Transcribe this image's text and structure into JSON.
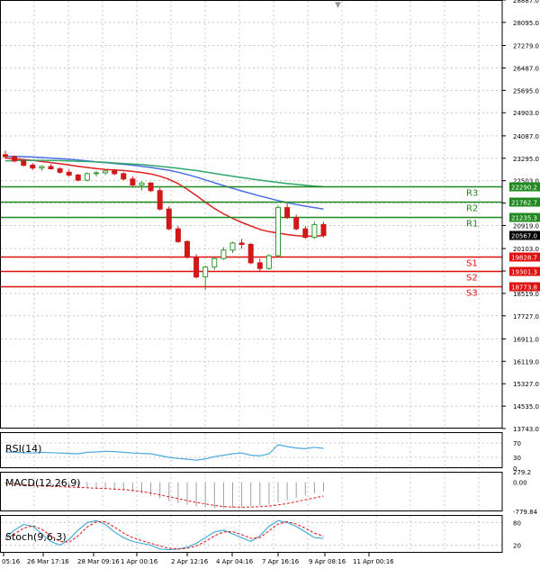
{
  "colors": {
    "background": "#ffffff",
    "grid": "#c8c8c8",
    "frame": "#000000",
    "bull_candle": "#2f9a2f",
    "bear_candle": "#d01818",
    "resistance": "#1f8a1f",
    "support": "#e01010",
    "ma_fast": "#e02020",
    "ma_mid": "#4a6fe0",
    "ma_slow": "#2fa86a",
    "rsi": "#4aa8e0",
    "macd_hist": "#a0a0a0",
    "macd_signal": "#e02020",
    "stoch_main": "#3aa8d8",
    "stoch_signal": "#e02020",
    "label_box_green": "#1f8a1f",
    "label_box_red": "#e01010",
    "price_box": "#000000"
  },
  "chart_data": [
    {
      "type": "candlestick",
      "title": "",
      "ylim": [
        13743.0,
        28887.0
      ],
      "y_ticks": [
        "28887.0",
        "28095.0",
        "27279.0",
        "26487.0",
        "25695.0",
        "24903.0",
        "24087.0",
        "23295.0",
        "22503.0",
        "21711.0",
        "20919.0",
        "20103.0",
        "19311.0",
        "18519.0",
        "17727.0",
        "16911.0",
        "16119.0",
        "15327.0",
        "14535.0",
        "13743.0"
      ],
      "x_ticks": [
        "05:16",
        "26 Mar 17:16",
        "28 Mar 09:16",
        "1 Apr 00:16",
        "2 Apr 12:16",
        "4 Apr 04:16",
        "7 Apr 16:16",
        "9 Apr 08:16",
        "11 Apr 00:16"
      ],
      "levels": [
        {
          "label": "R3",
          "value": 22290.2,
          "value_text": "22290.2",
          "kind": "resistance"
        },
        {
          "label": "R2",
          "value": 21762.7,
          "value_text": "21762.7",
          "kind": "resistance"
        },
        {
          "label": "R1",
          "value": 21235.3,
          "value_text": "21235.3",
          "kind": "resistance"
        },
        {
          "label": "S1",
          "value": 19828.7,
          "value_text": "19828.7",
          "kind": "support"
        },
        {
          "label": "S2",
          "value": 19301.3,
          "value_text": "19301.3",
          "kind": "support"
        },
        {
          "label": "S3",
          "value": 18773.8,
          "value_text": "18773.8",
          "kind": "support"
        }
      ],
      "current_price": {
        "value": 20567.0,
        "text": "20567.0"
      },
      "candles": [
        [
          23420,
          23560,
          23280,
          23350
        ],
        [
          23350,
          23400,
          23150,
          23200
        ],
        [
          23200,
          23250,
          23000,
          23050
        ],
        [
          23050,
          23120,
          22880,
          22950
        ],
        [
          22950,
          23050,
          22850,
          23000
        ],
        [
          23000,
          23080,
          22900,
          22920
        ],
        [
          22920,
          22980,
          22750,
          22800
        ],
        [
          22800,
          22900,
          22650,
          22700
        ],
        [
          22700,
          22750,
          22480,
          22520
        ],
        [
          22520,
          22800,
          22480,
          22750
        ],
        [
          22750,
          22850,
          22650,
          22780
        ],
        [
          22780,
          22900,
          22700,
          22850
        ],
        [
          22850,
          22900,
          22700,
          22750
        ],
        [
          22750,
          22800,
          22520,
          22560
        ],
        [
          22560,
          22650,
          22300,
          22350
        ],
        [
          22350,
          22480,
          22150,
          22420
        ],
        [
          22420,
          22450,
          22100,
          22150
        ],
        [
          22150,
          22250,
          21450,
          21500
        ],
        [
          21500,
          21600,
          20750,
          20800
        ],
        [
          20800,
          20900,
          20300,
          20350
        ],
        [
          20350,
          20400,
          19750,
          19800
        ],
        [
          19800,
          19900,
          19050,
          19100
        ],
        [
          19100,
          19500,
          18650,
          19450
        ],
        [
          19450,
          19800,
          19350,
          19750
        ],
        [
          19750,
          20150,
          19700,
          20050
        ],
        [
          20050,
          20350,
          19950,
          20300
        ],
        [
          20300,
          20450,
          20100,
          20250
        ],
        [
          20250,
          20300,
          19550,
          19600
        ],
        [
          19600,
          19750,
          19300,
          19400
        ],
        [
          19400,
          19900,
          19350,
          19850
        ],
        [
          19850,
          21650,
          19800,
          21550
        ],
        [
          21550,
          21700,
          21150,
          21200
        ],
        [
          21200,
          21300,
          20750,
          20800
        ],
        [
          20800,
          20900,
          20450,
          20500
        ],
        [
          20500,
          21050,
          20450,
          20950
        ],
        [
          20950,
          21050,
          20500,
          20567
        ]
      ],
      "series": [
        {
          "name": "",
          "values": [
            23300,
            23280,
            23250,
            23220,
            23180,
            23140,
            23100,
            23060,
            23010,
            22970,
            22930,
            22900,
            22880,
            22860,
            22830,
            22790,
            22740,
            22660,
            22550,
            22400,
            22200,
            21980,
            21740,
            21520,
            21330,
            21170,
            21030,
            20900,
            20780,
            20700,
            20650,
            20600,
            20560,
            20540,
            20540,
            20560
          ]
        },
        {
          "name": "",
          "values": [
            23360,
            23360,
            23350,
            23340,
            23320,
            23300,
            23280,
            23260,
            23230,
            23200,
            23170,
            23140,
            23110,
            23080,
            23050,
            23010,
            22970,
            22920,
            22870,
            22800,
            22720,
            22630,
            22530,
            22430,
            22330,
            22230,
            22140,
            22050,
            21960,
            21880,
            21800,
            21730,
            21660,
            21600,
            21550,
            21500
          ]
        },
        {
          "name": "",
          "values": [
            23200,
            23210,
            23215,
            23220,
            23220,
            23215,
            23210,
            23200,
            23190,
            23180,
            23165,
            23150,
            23130,
            23110,
            23090,
            23070,
            23040,
            23010,
            22980,
            22940,
            22900,
            22860,
            22810,
            22760,
            22710,
            22660,
            22610,
            22570,
            22520,
            22480,
            22440,
            22400,
            22370,
            22340,
            22310,
            22290
          ]
        }
      ]
    },
    {
      "type": "line",
      "title": "RSI(14)",
      "ylim": [
        0,
        100
      ],
      "y_ticks": [
        "70",
        "30",
        "0"
      ],
      "series": [
        {
          "name": "RSI(14)",
          "values": [
            45,
            44,
            43,
            42,
            44,
            43,
            42,
            41,
            40,
            44,
            45,
            47,
            46,
            44,
            42,
            41,
            40,
            35,
            30,
            27,
            25,
            22,
            26,
            32,
            36,
            40,
            42,
            36,
            34,
            40,
            65,
            60,
            56,
            54,
            58,
            55
          ]
        }
      ]
    },
    {
      "type": "bar",
      "title": "MACD(12,26,9)",
      "ylim": [
        -779.84,
        279.2
      ],
      "y_ticks": [
        "279.2",
        "0.00",
        "-779.84"
      ],
      "values": [
        -40,
        -60,
        -80,
        -100,
        -110,
        -120,
        -130,
        -140,
        -150,
        -160,
        -170,
        -180,
        -200,
        -220,
        -250,
        -300,
        -360,
        -430,
        -500,
        -560,
        -610,
        -650,
        -680,
        -700,
        -700,
        -690,
        -670,
        -650,
        -630,
        -600,
        -540,
        -480,
        -420,
        -360,
        -300,
        -250
      ],
      "series": [
        {
          "name": "",
          "values": [
            -30,
            -50,
            -70,
            -85,
            -100,
            -110,
            -120,
            -130,
            -140,
            -150,
            -160,
            -170,
            -185,
            -200,
            -220,
            -250,
            -290,
            -340,
            -390,
            -440,
            -490,
            -540,
            -580,
            -620,
            -650,
            -665,
            -670,
            -665,
            -655,
            -640,
            -610,
            -570,
            -520,
            -470,
            -420,
            -370
          ]
        }
      ]
    },
    {
      "type": "line",
      "title": "Stoch(9,6,3)",
      "ylim": [
        0,
        100
      ],
      "y_ticks": [
        "80",
        "20"
      ],
      "series": [
        {
          "name": "",
          "values": [
            40,
            60,
            75,
            70,
            50,
            30,
            20,
            35,
            60,
            80,
            85,
            75,
            55,
            40,
            30,
            25,
            20,
            10,
            8,
            10,
            15,
            25,
            40,
            55,
            60,
            50,
            40,
            30,
            45,
            70,
            85,
            80,
            70,
            55,
            40,
            38
          ]
        },
        {
          "name": "",
          "values": [
            35,
            50,
            65,
            72,
            62,
            45,
            30,
            28,
            45,
            68,
            82,
            82,
            68,
            52,
            40,
            32,
            25,
            18,
            12,
            10,
            12,
            18,
            30,
            45,
            55,
            56,
            48,
            38,
            40,
            58,
            76,
            82,
            76,
            65,
            52,
            44
          ]
        }
      ]
    }
  ]
}
